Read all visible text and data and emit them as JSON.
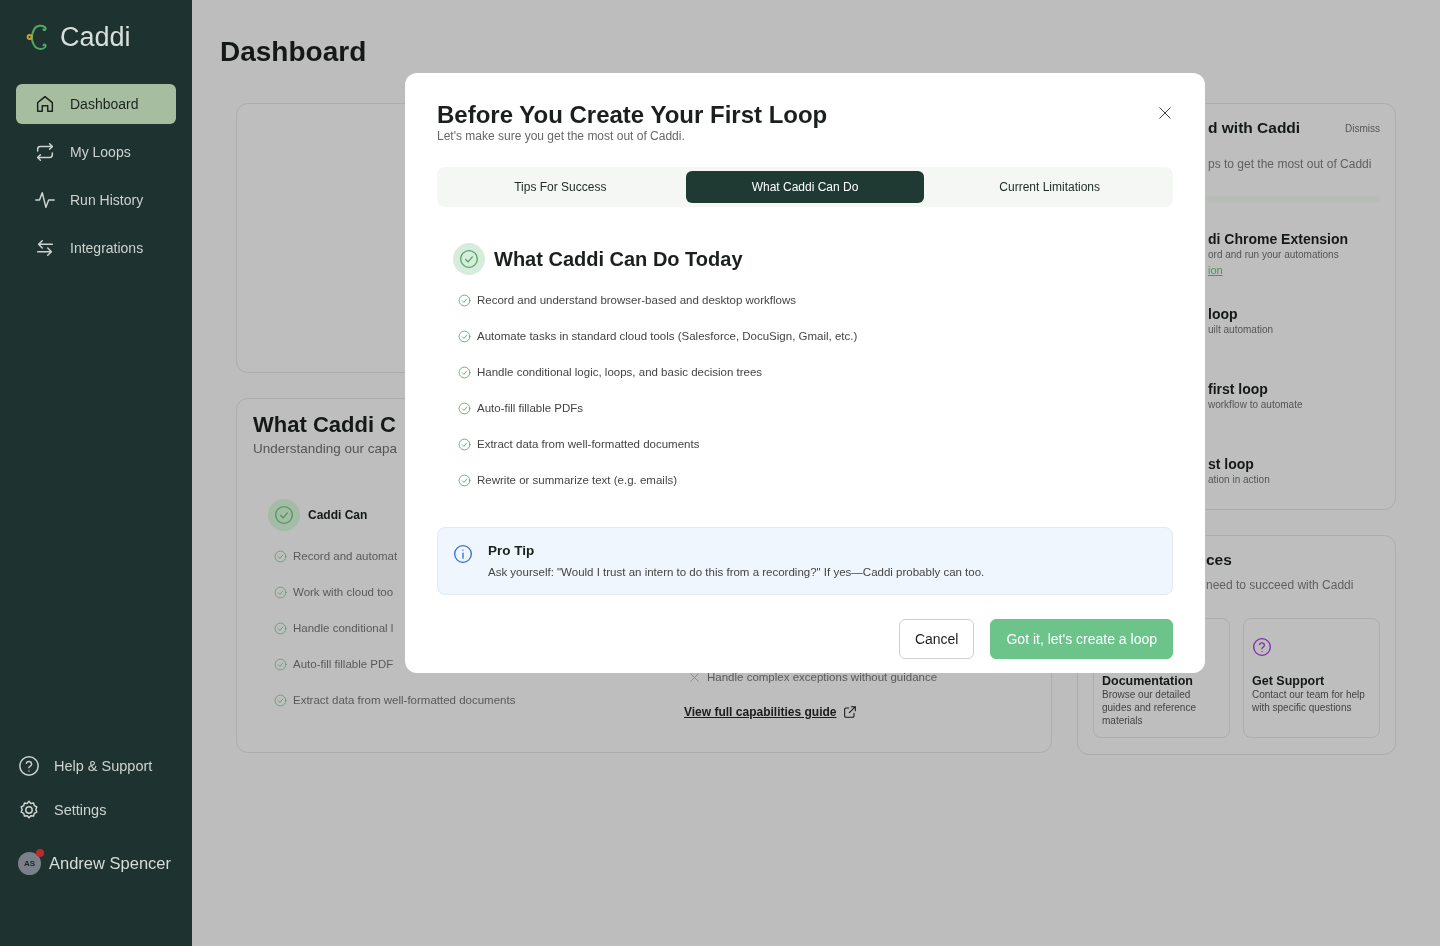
{
  "sidebar": {
    "logo": "Caddi",
    "nav": [
      {
        "label": "Dashboard",
        "kind": "home",
        "selected": true
      },
      {
        "label": "My Loops",
        "kind": "loops",
        "selected": false
      },
      {
        "label": "Run History",
        "kind": "activity",
        "selected": false
      },
      {
        "label": "Integrations",
        "kind": "integrations",
        "selected": false
      }
    ],
    "footer": [
      {
        "label": "Help & Support",
        "kind": "help"
      },
      {
        "label": "Settings",
        "kind": "settings"
      }
    ],
    "user": {
      "initials": "AS",
      "name": "Andrew Spencer",
      "notification": true
    }
  },
  "page": {
    "title": "Dashboard"
  },
  "capabilities_card": {
    "title": "What Caddi C",
    "subtitle": "Understanding our capa",
    "can_heading": "Caddi Can",
    "can_items": [
      "Record and automat",
      "Work with cloud too",
      "Handle conditional l",
      "Auto-fill fillable PDF",
      "Extract data from well-formatted documents"
    ],
    "cannot_items": [
      "Handle complex exceptions without guidance"
    ],
    "guide_link": "View full capabilities guide"
  },
  "getting_started_card": {
    "title": "d with Caddi",
    "dismiss": "Dismiss",
    "subtitle": "ps to get the most out of Caddi",
    "steps": [
      {
        "title": "di Chrome Extension",
        "description": "ord and run your automations",
        "link": "ion"
      },
      {
        "title": "loop",
        "description": "uilt automation"
      },
      {
        "title": "first loop",
        "description": "workflow to automate"
      },
      {
        "title": "st loop",
        "description": "ation in action"
      }
    ]
  },
  "resources_card": {
    "title": "ces",
    "subtitle": "need to succeed with Caddi",
    "resources": [
      {
        "kind": "docs",
        "title": "Documentation",
        "description": "Browse our detailed guides and reference materials"
      },
      {
        "kind": "support",
        "title": "Get Support",
        "description": "Contact our team for help with specific questions"
      }
    ]
  },
  "modal": {
    "title": "Before You Create Your First Loop",
    "subtitle": "Let's make sure you get the most out of Caddi.",
    "tabs": [
      {
        "label": "Tips For Success",
        "selected": false
      },
      {
        "label": "What Caddi Can Do",
        "selected": true
      },
      {
        "label": "Current Limitations",
        "selected": false
      }
    ],
    "section_title": "What Caddi Can Do Today",
    "items": [
      "Record and understand browser-based and desktop workflows",
      "Automate tasks in standard cloud tools (Salesforce, DocuSign, Gmail, etc.)",
      "Handle conditional logic, loops, and basic decision trees",
      "Auto-fill fillable PDFs",
      "Extract data from well-formatted documents",
      "Rewrite or summarize text (e.g. emails)"
    ],
    "tip": {
      "title": "Pro Tip",
      "text": "Ask yourself: \"Would I trust an intern to do this from a recording?\" If yes—Caddi probably can too."
    },
    "buttons": [
      {
        "label": "Cancel",
        "kind": "secondary"
      },
      {
        "label": "Got it, let's create a loop",
        "kind": "primary"
      }
    ]
  }
}
